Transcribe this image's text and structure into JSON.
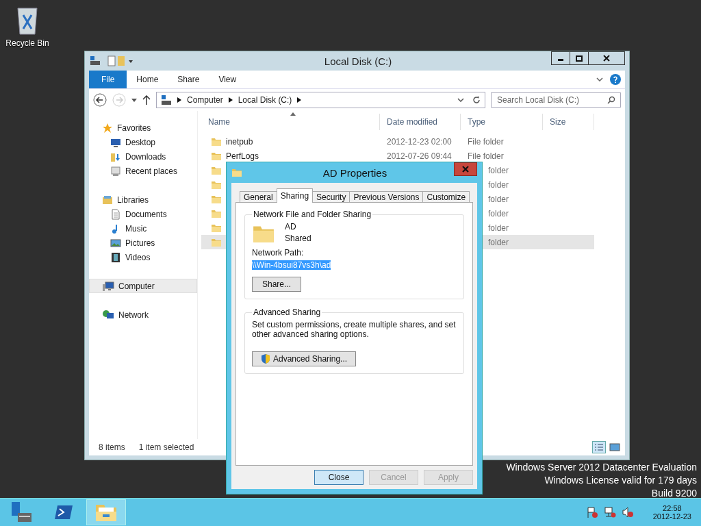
{
  "desktop_icons": [
    {
      "label": "Recycle Bin"
    }
  ],
  "explorer": {
    "title": "Local Disk (C:)",
    "ribbon_tabs": [
      {
        "label": "File",
        "kind": "file"
      },
      {
        "label": "Home",
        "kind": "tab"
      },
      {
        "label": "Share",
        "kind": "tab"
      },
      {
        "label": "View",
        "kind": "tab"
      }
    ],
    "address": [
      "Computer",
      "Local Disk (C:)"
    ],
    "search": {
      "placeholder": "Search Local Disk (C:)"
    },
    "navigation": [
      {
        "label": "Favorites",
        "kind": "star",
        "selected": false,
        "children": [
          {
            "label": "Desktop",
            "kind": "desktop",
            "selected": false
          },
          {
            "label": "Downloads",
            "kind": "downloads",
            "selected": false
          },
          {
            "label": "Recent places",
            "kind": "recent",
            "selected": false
          }
        ]
      },
      {
        "label": "Libraries",
        "kind": "library",
        "selected": false,
        "children": [
          {
            "label": "Documents",
            "kind": "document",
            "selected": false
          },
          {
            "label": "Music",
            "kind": "music",
            "selected": false
          },
          {
            "label": "Pictures",
            "kind": "pictures",
            "selected": false
          },
          {
            "label": "Videos",
            "kind": "videos",
            "selected": false
          }
        ]
      },
      {
        "label": "Computer",
        "kind": "computer",
        "selected": true
      },
      {
        "label": "Network",
        "kind": "network",
        "selected": false
      }
    ],
    "columns": [
      {
        "label": "Name",
        "sorted": true
      },
      {
        "label": "Date modified",
        "sorted": false
      },
      {
        "label": "Type",
        "sorted": false
      },
      {
        "label": "Size",
        "sorted": false
      }
    ],
    "rows": [
      {
        "name": "inetpub",
        "date": "2012-12-23 02:00",
        "type": "File folder",
        "selected": false
      },
      {
        "name": "PerfLogs",
        "date": "2012-07-26 09:44",
        "type": "File folder",
        "selected": false
      },
      {
        "type": "folder",
        "selected": false
      },
      {
        "type": "folder",
        "selected": false
      },
      {
        "type": "folder",
        "selected": false
      },
      {
        "type": "folder",
        "selected": false
      },
      {
        "type": "folder",
        "selected": false
      },
      {
        "type": "folder",
        "selected": true
      }
    ],
    "status_bar": {
      "count": "8 items",
      "selection": "1 item selected"
    }
  },
  "dialog": {
    "title": "AD Properties",
    "tabs": [
      {
        "label": "General",
        "selected": false
      },
      {
        "label": "Sharing",
        "selected": true
      },
      {
        "label": "Security",
        "selected": false
      },
      {
        "label": "Previous Versions",
        "selected": false
      },
      {
        "label": "Customize",
        "selected": false
      }
    ],
    "network_sharing": {
      "heading": "Network File and Folder Sharing",
      "name": "AD",
      "status": "Shared",
      "path_label": "Network Path:",
      "path": "\\\\Win-4bsui87vs3h\\ad",
      "button": "Share..."
    },
    "advanced_sharing": {
      "heading": "Advanced Sharing",
      "description": "Set custom permissions, create multiple shares, and set other advanced sharing options.",
      "button": "Advanced Sharing..."
    },
    "buttons": [
      {
        "label": "Close",
        "default": true,
        "disabled": false
      },
      {
        "label": "Cancel",
        "default": false,
        "disabled": true
      },
      {
        "label": "Apply",
        "default": false,
        "disabled": true
      }
    ]
  },
  "license_notice": [
    "Windows Server 2012 Datacenter Evaluation",
    "Windows License valid for 179 days",
    "Build 9200"
  ],
  "taskbar": {
    "apps": [
      {
        "kind": "server-manager",
        "selected": false
      },
      {
        "kind": "powershell",
        "selected": false
      },
      {
        "kind": "explorer",
        "selected": true
      }
    ],
    "time": "22:58",
    "date": "2012-12-23"
  }
}
